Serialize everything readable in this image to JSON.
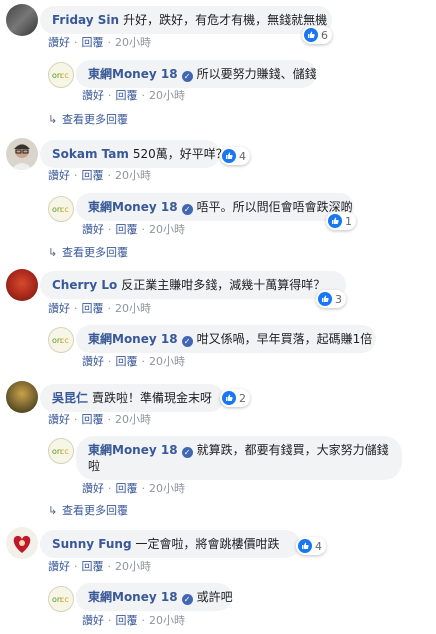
{
  "actions": {
    "like": "讚好",
    "reply": "回覆",
    "sep": "·"
  },
  "time": "20小時",
  "more_replies": "查看更多回覆",
  "comments": [
    {
      "name": "Friday Sin",
      "text": "升好，跌好，有危才有機，無錢就無機",
      "reactions": "6",
      "reply": {
        "name": "東網Money 18",
        "text": "所以要努力賺錢、儲錢",
        "reactions": ""
      },
      "more": true
    },
    {
      "name": "Sokam Tam",
      "text": "520萬，好平咩？",
      "reactions": "4",
      "reply": {
        "name": "東網Money 18",
        "text": "唔平。所以問佢會唔會跌深啲",
        "reactions": "1"
      },
      "more": true
    },
    {
      "name": "Cherry Lo",
      "text": "反正業主賺咁多錢，減幾十萬算得咩？",
      "reactions": "3",
      "reply": {
        "name": "東網Money 18",
        "text": "咁又係喎，早年買落，起碼賺1倍",
        "reactions": ""
      },
      "more": false
    },
    {
      "name": "吳昆仁",
      "text": "賣跌啦！準備現金末呀",
      "reactions": "2",
      "reply": {
        "name": "東網Money 18",
        "text": "就算跌，都要有錢買，大家努力儲錢啦",
        "reactions": ""
      },
      "more": true
    },
    {
      "name": "Sunny Fung",
      "text": "一定會啦，將會跳樓價咁跌",
      "reactions": "4",
      "reply": {
        "name": "東網Money 18",
        "text": "或許吧",
        "reactions": ""
      },
      "more": false
    }
  ],
  "icons": {
    "like": "thumbs-up-icon",
    "haha": "haha-emoji-icon",
    "verified": "verified-badge-icon",
    "reply_arrow": "reply-arrow-icon"
  },
  "colors": {
    "name": "#385898",
    "bubble": "#f2f3f5",
    "like": "#1877f2"
  }
}
